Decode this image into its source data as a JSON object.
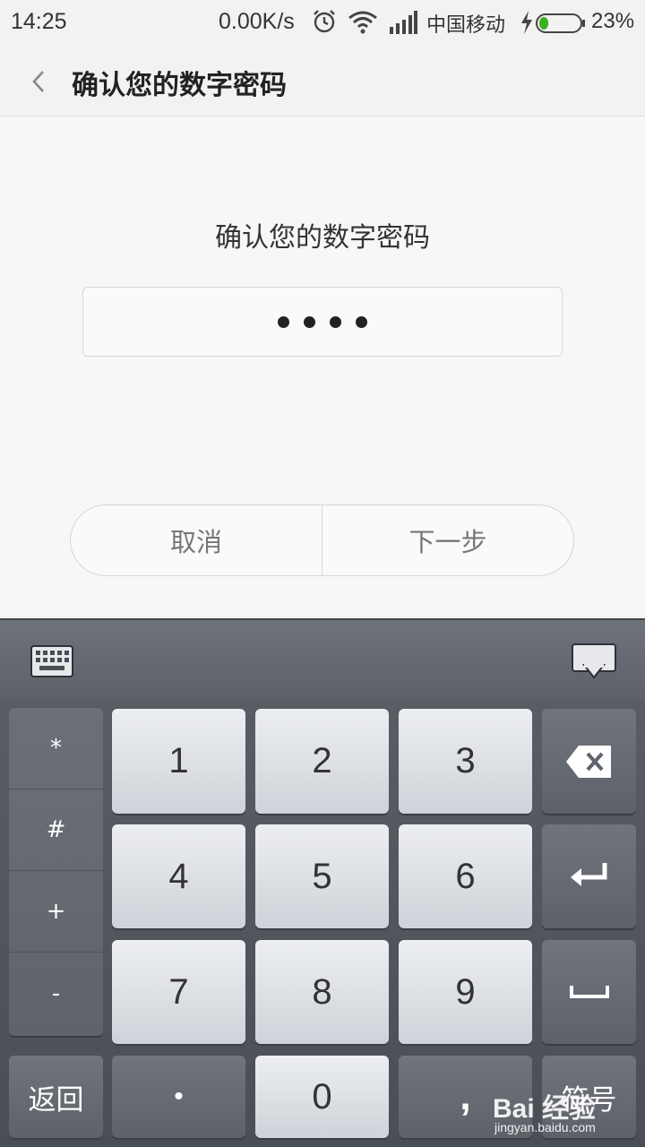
{
  "status": {
    "time": "14:25",
    "speed": "0.00K/s",
    "carrier": "中国移动",
    "battery_pct": "23%",
    "battery_level": 0.23,
    "icons": [
      "alarm-icon",
      "wifi-icon",
      "signal-icon",
      "charging-icon",
      "battery-icon"
    ]
  },
  "header": {
    "title": "确认您的数字密码"
  },
  "main": {
    "prompt": "确认您的数字密码",
    "pin_length": 4,
    "buttons": {
      "cancel": "取消",
      "next": "下一步"
    }
  },
  "keyboard": {
    "symbols": [
      "*",
      "#",
      "+",
      "-"
    ],
    "digits": [
      "1",
      "2",
      "3",
      "4",
      "5",
      "6",
      "7",
      "8",
      "9"
    ],
    "back": "返回",
    "dot": "•",
    "zero": "0",
    "comma": ",",
    "symbol_key": "符号"
  },
  "watermark": {
    "brand": "Bai 经验",
    "url": "jingyan.baidu.com"
  },
  "colors": {
    "accent_battery": "#3cb01e",
    "keyboard_bg": "#4a4e55"
  }
}
